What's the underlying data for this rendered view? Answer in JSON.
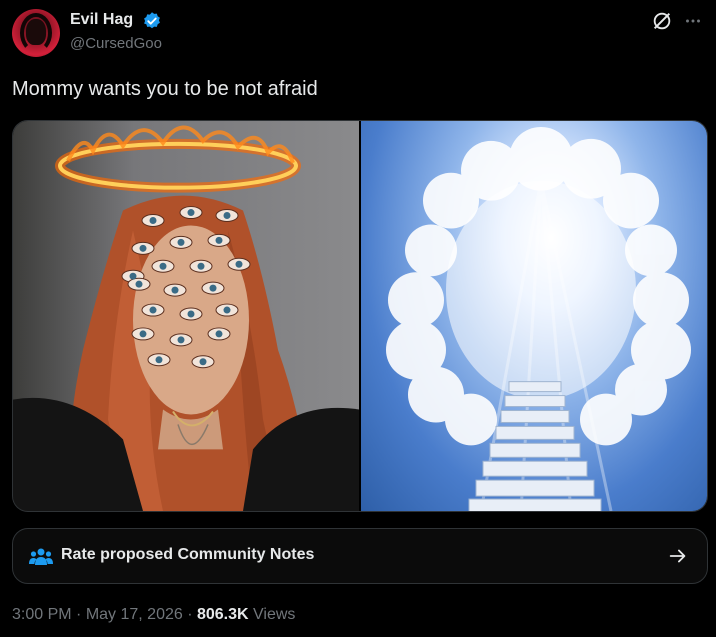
{
  "author": {
    "name": "Evil Hag",
    "handle": "@CursedGoo",
    "verified": true
  },
  "tweet": {
    "text": "Mommy wants you to be not afraid"
  },
  "community_notes": {
    "label": "Rate proposed Community Notes"
  },
  "meta": {
    "time": "3:00 PM",
    "dot1": " · ",
    "date": "May 17, 2026",
    "dot2": " · ",
    "views_count": "806.3K",
    "views_label": " Views"
  },
  "colors": {
    "accent": "#1d9bf0",
    "muted": "#71767b",
    "text": "#e7e9ea"
  },
  "icons": [
    "verified-badge-icon",
    "grok-icon",
    "more-icon",
    "community-notes-icon",
    "arrow-right-icon"
  ]
}
